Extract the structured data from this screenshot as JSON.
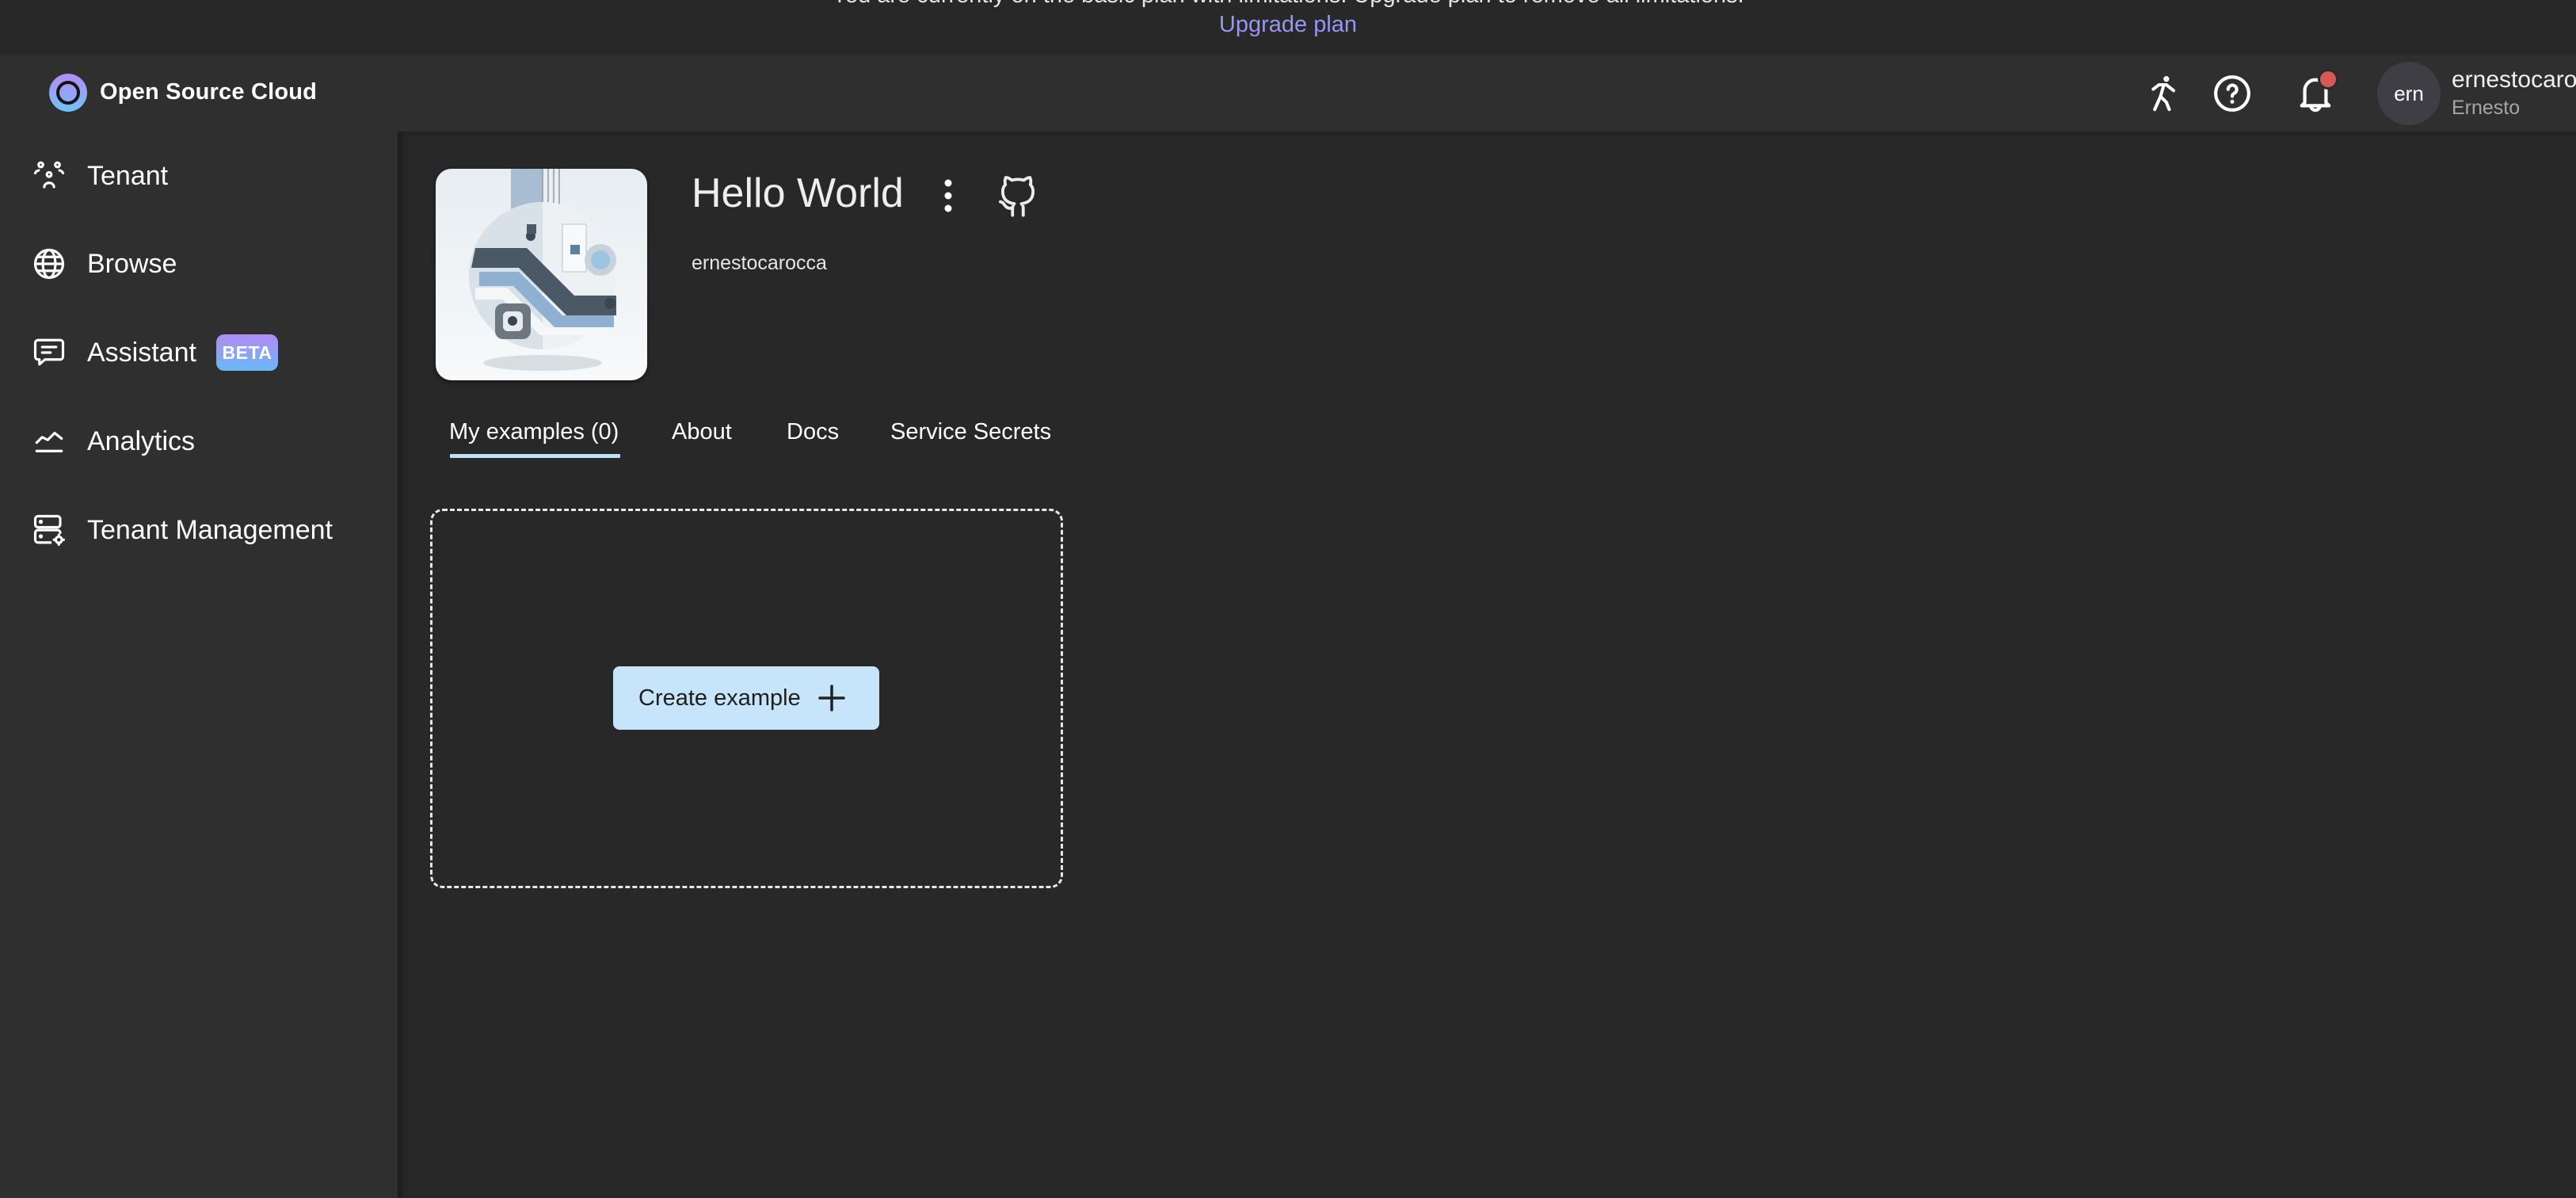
{
  "banner": {
    "message": "You are currently on the basic plan with limitations. Upgrade plan to remove all limitations.",
    "link_label": "Upgrade plan"
  },
  "header": {
    "brand": "Open Source Cloud",
    "icons": [
      "walk-icon",
      "help-icon",
      "bell-icon"
    ],
    "notifications_unread": true,
    "user": {
      "avatar_initials": "ern",
      "username": "ernestocaro",
      "display_name": "Ernesto"
    }
  },
  "sidebar": {
    "items": [
      {
        "label": "Tenant",
        "icon": "users-icon"
      },
      {
        "label": "Browse",
        "icon": "globe-icon"
      },
      {
        "label": "Assistant",
        "icon": "chat-icon",
        "badge": "BETA"
      },
      {
        "label": "Analytics",
        "icon": "analytics-icon"
      },
      {
        "label": "Tenant Management",
        "icon": "server-settings-icon"
      }
    ]
  },
  "service": {
    "title": "Hello World",
    "owner": "ernestocarocca",
    "tabs": [
      {
        "label": "My examples (0)",
        "active": true
      },
      {
        "label": "About",
        "active": false
      },
      {
        "label": "Docs",
        "active": false
      },
      {
        "label": "Service Secrets",
        "active": false
      }
    ],
    "create_button_label": "Create example"
  },
  "colors": {
    "accent_button": "#c6e4fa",
    "tab_underline": "#bfe0f7",
    "notification_dot": "#d45a58",
    "link_gradient_start": "#7fa6f3",
    "link_gradient_end": "#a98af5",
    "badge_gradient_start": "#b08cf4",
    "badge_gradient_end": "#6ab8f6"
  }
}
